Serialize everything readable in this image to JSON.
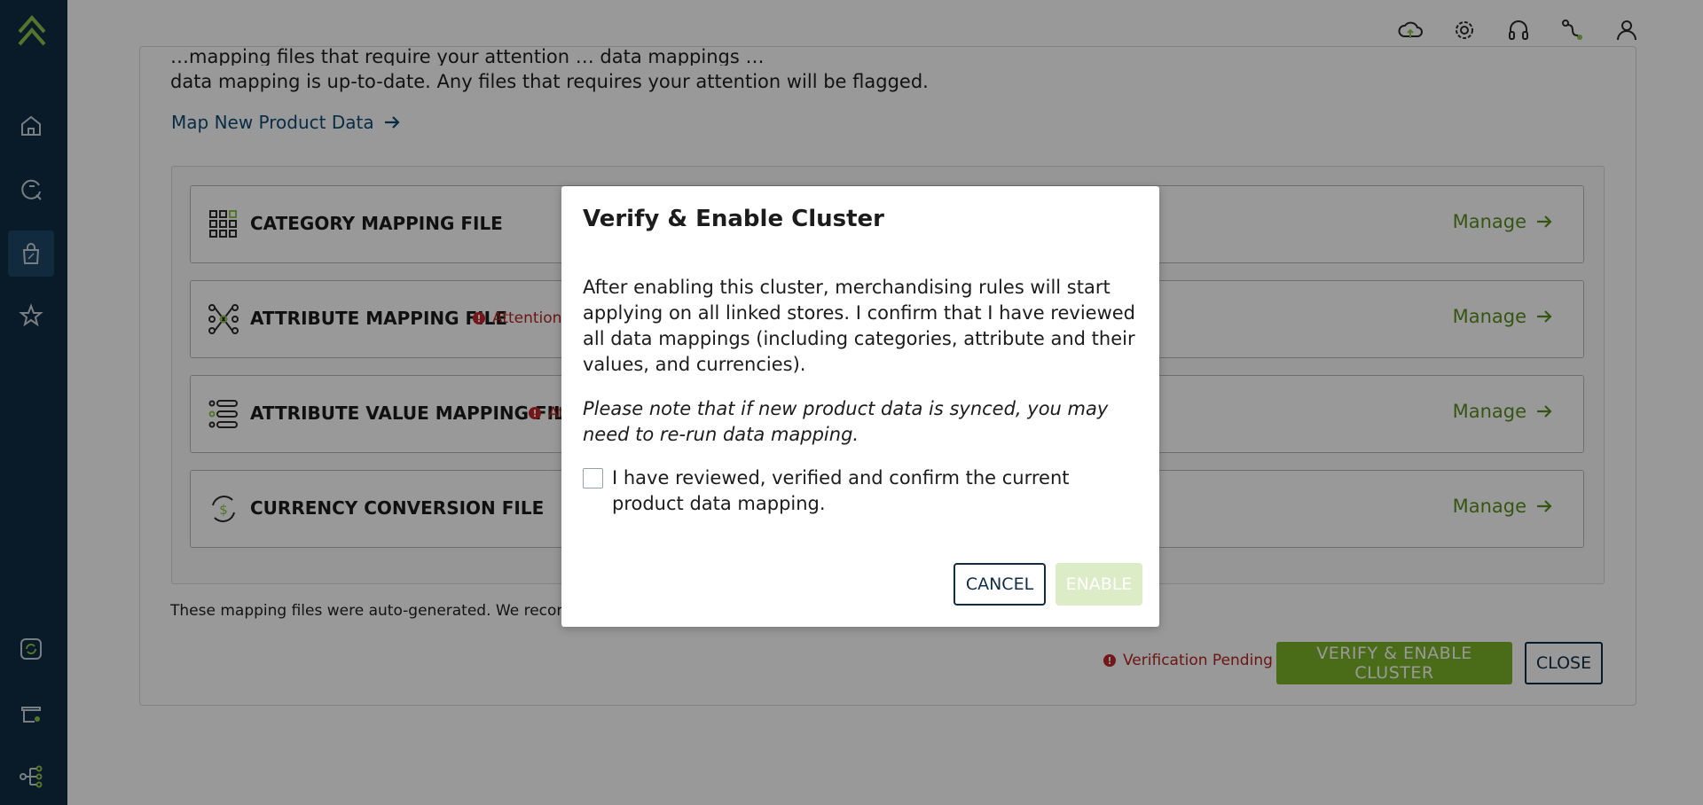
{
  "intro": {
    "line1_partial": "…mapping files that require your attention … data mappings …",
    "line2": "data mapping is up-to-date. Any files that requires your attention will be flagged."
  },
  "map_new_link": "Map New Product Data",
  "files": [
    {
      "title": "CATEGORY MAPPING FILE",
      "icon": "category-grid-icon",
      "attention": "",
      "manage": "Manage"
    },
    {
      "title": "ATTRIBUTE MAPPING FILE",
      "icon": "attribute-nodes-icon",
      "attention": "Attention",
      "manage": "Manage"
    },
    {
      "title": "ATTRIBUTE VALUE MAPPING FILE",
      "icon": "attribute-list-icon",
      "attention": "At",
      "manage": "Manage"
    },
    {
      "title": "CURRENCY CONVERSION FILE",
      "icon": "currency-cycle-icon",
      "attention": "",
      "manage": "Manage"
    }
  ],
  "footnote": "These mapping files were auto-generated. We recomm",
  "status": {
    "pending": "Verification Pending"
  },
  "actions": {
    "verify": "VERIFY & ENABLE CLUSTER",
    "close": "CLOSE"
  },
  "modal": {
    "title": "Verify & Enable Cluster",
    "body": "After enabling this cluster, merchandising rules will start applying on all linked stores. I confirm that I have reviewed all data mappings (including categories, attribute and their values, and currencies).",
    "note": "Please note that if new product data is synced, you may need to re-run data mapping.",
    "checkbox_label": "I have reviewed, verified and confirm the current product data mapping.",
    "checkbox_checked": false,
    "cancel": "CANCEL",
    "enable": "ENABLE"
  },
  "sidebar": {
    "logo": "brand-chevron-logo",
    "items": [
      {
        "icon": "home-icon",
        "active": false
      },
      {
        "icon": "analytics-icon",
        "active": false
      },
      {
        "icon": "shopping-bag-icon",
        "active": true
      },
      {
        "icon": "star-icon",
        "active": false
      },
      {
        "icon": "sync-icon",
        "active": false
      },
      {
        "icon": "store-icon",
        "active": false
      },
      {
        "icon": "hierarchy-icon",
        "active": false
      }
    ]
  },
  "topbar": {
    "icons": [
      "cloud-upload-icon",
      "settings-gear-icon",
      "headset-icon",
      "route-icon",
      "user-icon"
    ]
  },
  "colors": {
    "sidebar": "#0f2d45",
    "accent_green": "#7cb52a",
    "link_blue": "#0f4a73",
    "warning_red": "#b3261e"
  }
}
